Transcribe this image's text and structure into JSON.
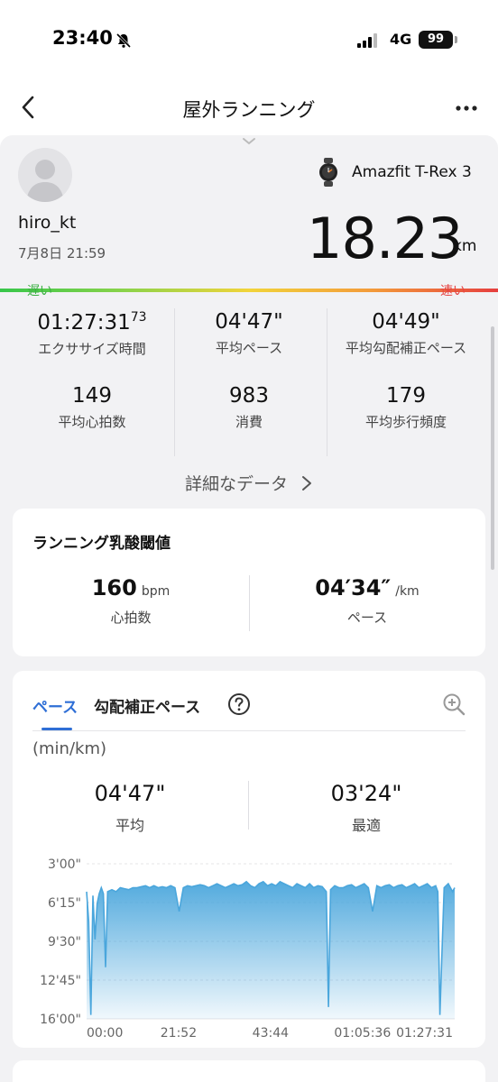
{
  "status_bar": {
    "time": "23:40",
    "network": "4G",
    "battery": "99"
  },
  "header": {
    "title": "屋外ランニング",
    "back_icon": "chevron-left-icon",
    "more_icon": "more-horizontal-icon"
  },
  "profile": {
    "username": "hiro_kt",
    "datetime": "7月8日 21:59"
  },
  "device": {
    "name": "Amazfit T-Rex 3",
    "icon": "watch-icon"
  },
  "distance": {
    "value": "18.23",
    "unit": "km"
  },
  "pace_scale": {
    "slow_label": "遅い",
    "fast_label": "速い"
  },
  "stats": [
    {
      "value": "01:27:31",
      "sub": "73",
      "label": "エクササイズ時間"
    },
    {
      "value": "04'47\"",
      "sub": "",
      "label": "平均ペース"
    },
    {
      "value": "04'49\"",
      "sub": "",
      "label": "平均勾配補正ペース"
    },
    {
      "value": "149",
      "sub": "",
      "label": "平均心拍数"
    },
    {
      "value": "983",
      "sub": "",
      "label": "消費"
    },
    {
      "value": "179",
      "sub": "",
      "label": "平均歩行頻度"
    }
  ],
  "details_link": "詳細なデータ",
  "lactate_threshold": {
    "title": "ランニング乳酸閾値",
    "hr_value": "160",
    "hr_unit": "bpm",
    "hr_label": "心拍数",
    "pace_value": "04′34″",
    "pace_unit": "/km",
    "pace_label": "ペース"
  },
  "pace_card": {
    "tabs": [
      "ペース",
      "勾配補正ペース"
    ],
    "active_tab": 0,
    "help_icon": "question-circle-icon",
    "zoom_icon": "zoom-in-icon",
    "unit": "(min/km)",
    "average_value": "04'47\"",
    "average_label": "平均",
    "best_value": "03'24\"",
    "best_label": "最適"
  },
  "colors": {
    "accent": "#2f6fd6",
    "chart_fill": "#4aa6dc",
    "slow": "#3cb043",
    "fast": "#e64545"
  },
  "chart_data": {
    "type": "area",
    "title": "",
    "xlabel": "",
    "ylabel": "(min/km)",
    "y_ticks": [
      "3'00\"",
      "6'15\"",
      "9'30\"",
      "12'45\"",
      "16'00\""
    ],
    "y_ticks_sec": [
      180,
      375,
      570,
      765,
      960
    ],
    "x_ticks": [
      "00:00",
      "21:52",
      "43:44",
      "01:05:36",
      "01:27:31"
    ],
    "x_ticks_min": [
      0,
      21.87,
      43.73,
      65.6,
      87.52
    ],
    "ylim_sec": [
      180,
      960
    ],
    "y_inverted": true,
    "xlim_min": [
      0,
      87.52
    ],
    "grid": true,
    "series": [
      {
        "x_min": [
          0,
          0.5,
          1,
          1.5,
          2,
          2.5,
          3,
          3.5,
          4,
          4.5,
          5,
          6,
          7,
          8,
          9,
          10,
          11,
          12,
          13,
          14,
          15,
          16,
          17,
          18,
          19,
          20,
          21,
          22,
          23,
          24,
          25,
          26,
          27,
          28,
          29,
          30,
          31,
          32,
          33,
          34,
          35,
          36,
          37,
          38,
          39,
          40,
          41,
          42,
          43,
          44,
          45,
          46,
          47,
          48,
          49,
          50,
          51,
          52,
          53,
          54,
          55,
          56,
          57,
          57.5,
          58,
          59,
          60,
          61,
          62,
          63,
          64,
          65,
          66,
          67,
          68,
          69,
          70,
          71,
          72,
          73,
          74,
          75,
          76,
          77,
          78,
          79,
          80,
          81,
          82,
          83,
          83.5,
          84,
          85,
          86,
          87,
          87.52
        ],
        "y_sec": [
          320,
          470,
          940,
          340,
          560,
          380,
          330,
          300,
          330,
          700,
          320,
          310,
          320,
          300,
          305,
          310,
          300,
          300,
          295,
          290,
          300,
          290,
          300,
          295,
          300,
          290,
          300,
          420,
          300,
          290,
          295,
          290,
          285,
          290,
          300,
          290,
          280,
          290,
          300,
          290,
          280,
          290,
          285,
          270,
          290,
          300,
          280,
          270,
          290,
          280,
          290,
          270,
          280,
          290,
          300,
          280,
          290,
          300,
          280,
          300,
          290,
          295,
          320,
          900,
          310,
          290,
          300,
          300,
          290,
          285,
          300,
          290,
          280,
          300,
          420,
          290,
          300,
          290,
          285,
          300,
          290,
          285,
          300,
          290,
          280,
          300,
          290,
          280,
          300,
          290,
          320,
          940,
          300,
          280,
          320,
          300
        ]
      }
    ]
  }
}
